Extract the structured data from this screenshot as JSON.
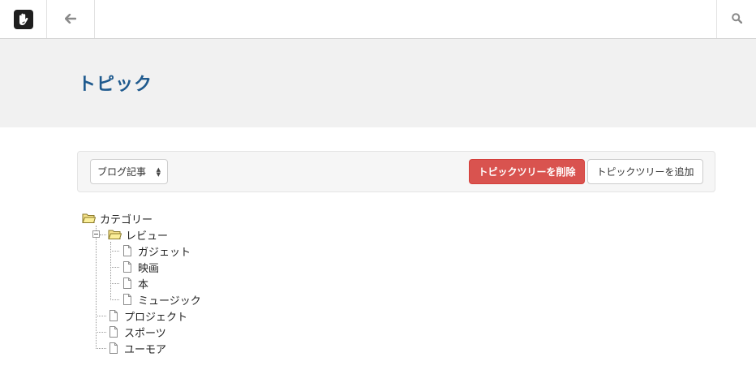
{
  "topbar": {
    "logo_icon": "concrete5-logo",
    "back_icon": "arrow-left-icon",
    "search_icon": "search-icon"
  },
  "page": {
    "title": "トピック"
  },
  "toolbar": {
    "select_value": "ブログ記事",
    "delete_label": "トピックツリーを削除",
    "add_label": "トピックツリーを追加",
    "delete_color": "#d9534f"
  },
  "tree": {
    "root": "カテゴリー",
    "category": "レビュー",
    "review_items": [
      "ガジェット",
      "映画",
      "本",
      "ミュージック"
    ],
    "root_items": [
      "プロジェクト",
      "スポーツ",
      "ユーモア"
    ]
  }
}
